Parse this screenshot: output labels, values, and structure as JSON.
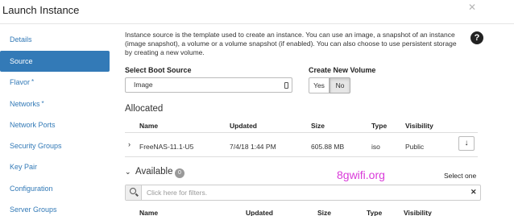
{
  "dialog": {
    "title": "Launch Instance",
    "close_glyph": "✕"
  },
  "sidebar": {
    "items": [
      {
        "label": "Details",
        "required": false,
        "active": false
      },
      {
        "label": "Source",
        "required": false,
        "active": true
      },
      {
        "label": "Flavor",
        "required": true,
        "active": false
      },
      {
        "label": "Networks",
        "required": true,
        "active": false
      },
      {
        "label": "Network Ports",
        "required": false,
        "active": false
      },
      {
        "label": "Security Groups",
        "required": false,
        "active": false
      },
      {
        "label": "Key Pair",
        "required": false,
        "active": false
      },
      {
        "label": "Configuration",
        "required": false,
        "active": false
      },
      {
        "label": "Server Groups",
        "required": false,
        "active": false
      }
    ],
    "required_marker": "*"
  },
  "source": {
    "description": "Instance source is the template used to create an instance. You can use an image, a snapshot of an instance (image snapshot), a volume or a volume snapshot (if enabled). You can also choose to use persistent storage by creating a new volume.",
    "help_glyph": "?",
    "boot_source_label": "Select Boot Source",
    "boot_source_value": "Image",
    "create_volume_label": "Create New Volume",
    "create_volume_yes": "Yes",
    "create_volume_no": "No",
    "create_volume_selected": "No"
  },
  "allocated": {
    "title": "Allocated",
    "columns": [
      "Name",
      "Updated",
      "Size",
      "Type",
      "Visibility"
    ],
    "rows": [
      {
        "name": "FreeNAS-11.1-U5",
        "updated": "7/4/18 1:44 PM",
        "size": "605.88 MB",
        "type": "iso",
        "visibility": "Public"
      }
    ],
    "expand_glyph": "›",
    "move_glyph": "↓"
  },
  "available": {
    "title": "Available",
    "count": "0",
    "chevron_glyph": "⌄",
    "select_hint": "Select one",
    "filter_placeholder": "Click here for filters.",
    "clear_glyph": "✕",
    "columns": [
      "Name",
      "Updated",
      "Size",
      "Type",
      "Visibility"
    ]
  },
  "watermark": "8gwifi.org",
  "colors": {
    "accent": "#337ab7",
    "watermark": "#d93ad9",
    "badge": "#999999"
  }
}
